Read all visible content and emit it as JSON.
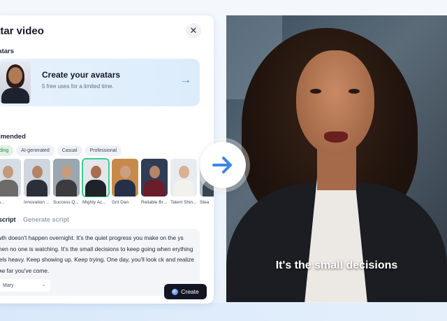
{
  "dialog": {
    "title": "atar video",
    "close_icon": "close-icon",
    "avatars_label": "vatars",
    "create_card": {
      "title": "Create your avatars",
      "subtitle": "5 free uses for a limited time."
    },
    "recommended_label": "mmended",
    "chips": [
      {
        "label": "ding",
        "active": true
      },
      {
        "label": "AI-generated",
        "active": false
      },
      {
        "label": "Casual",
        "active": false
      },
      {
        "label": "Professional",
        "active": false
      }
    ],
    "avatars": [
      {
        "name": "Ma...",
        "selected": false,
        "skin": "#c49a7a",
        "outfit": "#6d6a6a",
        "bg": "#d7dde4"
      },
      {
        "name": "Innovation ...",
        "selected": false,
        "skin": "#b58466",
        "outfit": "#2a2f3a",
        "bg": "#cfd6df"
      },
      {
        "name": "Success Q...",
        "selected": false,
        "skin": "#c79b7c",
        "outfit": "#3b3b40",
        "bg": "#9aa6b0"
      },
      {
        "name": "Mighty Ac...",
        "selected": true,
        "skin": "#a86c4e",
        "outfit": "#1f2228",
        "bg": "#e3e6ea"
      },
      {
        "name": "Grit Dan",
        "selected": false,
        "skin": "#caa085",
        "outfit": "#233048",
        "bg": "#c88a4a"
      },
      {
        "name": "Reliable Br...",
        "selected": false,
        "skin": "#b58466",
        "outfit": "#6a1e2a",
        "bg": "#2e3c55"
      },
      {
        "name": "Talent Shin...",
        "selected": false,
        "skin": "#d8b196",
        "outfit": "#f3f1ee",
        "bg": "#e8ecf0"
      },
      {
        "name": "Stea",
        "selected": false,
        "skin": "#a87e62",
        "outfit": "#3a4450",
        "bg": "#b0bcc6"
      }
    ],
    "script_tabs": {
      "active": "r script",
      "inactive": "Generate script"
    },
    "script_text": "owth doesn't happen overnight. It's the quiet progress you make on the ys when no one is watching. It's the small decisions to keep going when erything feels heavy. Keep showing up. Keep trying. One day, you'll look ck and realize how far you've come.",
    "voice": {
      "name": "Mary",
      "icon": "chevron-down-icon"
    },
    "create_button": "Create"
  },
  "video": {
    "caption": "It's the small decisions"
  },
  "arrow_icon": "arrow-right-icon",
  "colors": {
    "accent": "#3d86e6",
    "selected_outline": "#3dcf8e",
    "button": "#121623"
  }
}
